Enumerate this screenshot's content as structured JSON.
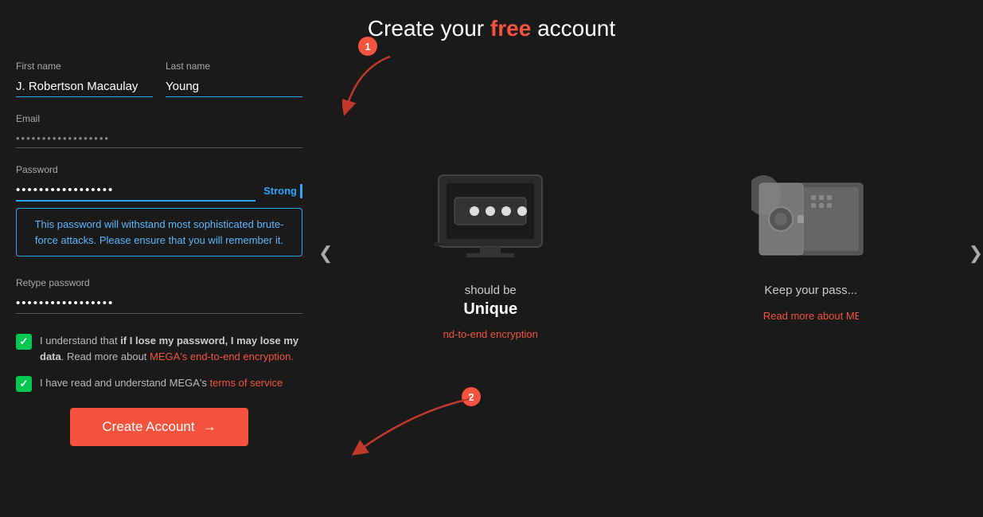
{
  "title": {
    "prefix": "Create your ",
    "highlight": "free",
    "suffix": " account"
  },
  "form": {
    "first_name_label": "First name",
    "first_name_value": "J. Robertson Macaulay",
    "last_name_label": "Last name",
    "last_name_value": "Young",
    "email_label": "Email",
    "email_placeholder": "••••••••••••••••••",
    "password_label": "Password",
    "password_value": "••••••••••••••",
    "strength_label": "Strong",
    "password_hint": "This password will withstand most sophisticated brute-force attacks. Please ensure that you will remember it.",
    "retype_label": "Retype password",
    "retype_value": "••••••••••••",
    "checkbox1_text_normal": "I understand that ",
    "checkbox1_text_bold": "if I lose my password, I may lose my data",
    "checkbox1_text_after": ". Read more about ",
    "checkbox1_link_text": "MEGA's end-to-end encryption.",
    "checkbox2_text": "I have read and understand MEGA's ",
    "checkbox2_link": "terms of service",
    "create_btn_label": "Create Account",
    "create_btn_arrow": "→"
  },
  "carousel": {
    "left_arrow": "❮",
    "right_arrow": "❯",
    "item1": {
      "subtitle": "should be",
      "title": "Unique",
      "link_text": "nd-to-end encryption"
    },
    "item2": {
      "subtitle": "Keep your pass",
      "title": "",
      "link_text": "Read more about MEGA's e"
    }
  },
  "annotations": {
    "num1": "1",
    "num2": "2"
  }
}
